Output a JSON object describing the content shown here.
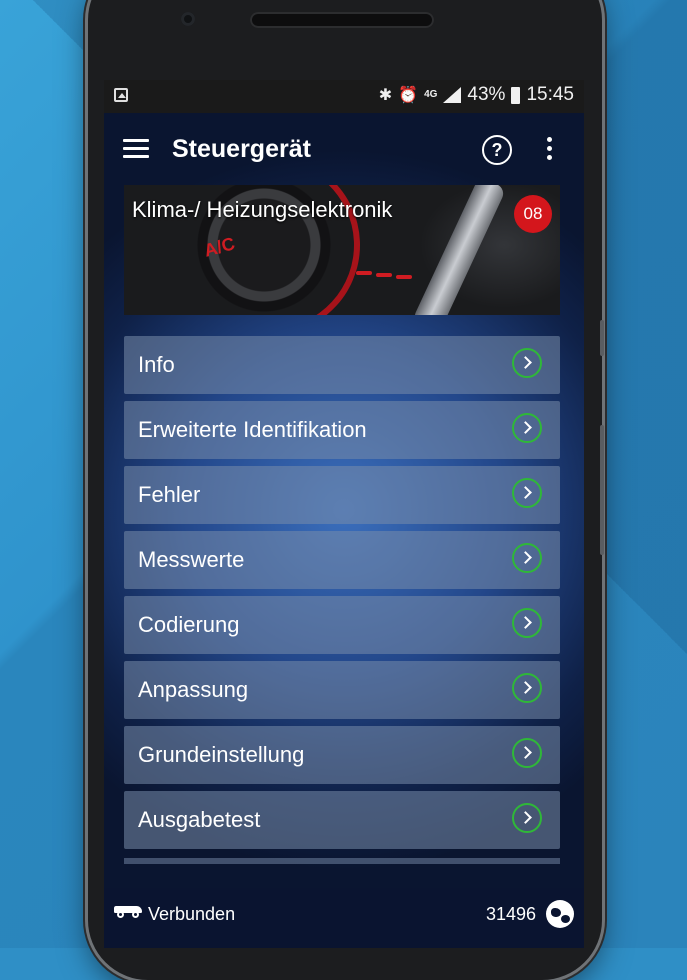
{
  "statusbar": {
    "icons": [
      "image-notification-icon",
      "bluetooth-icon",
      "alarm-icon",
      "4g-icon",
      "signal-icon",
      "battery-icon"
    ],
    "network": "4G",
    "battery": "43%",
    "time": "15:45"
  },
  "appbar": {
    "title": "Steuergerät",
    "help_symbol": "?"
  },
  "banner": {
    "title": "Klima-/ Heizungselektronik",
    "badge": "08",
    "image_text": "A/C"
  },
  "menu": {
    "items": [
      {
        "label": "Info"
      },
      {
        "label": "Erweiterte Identifikation"
      },
      {
        "label": "Fehler"
      },
      {
        "label": "Messwerte"
      },
      {
        "label": "Codierung"
      },
      {
        "label": "Anpassung"
      },
      {
        "label": "Grundeinstellung"
      },
      {
        "label": "Ausgabetest"
      }
    ]
  },
  "footer": {
    "status": "Verbunden",
    "counter": "31496"
  },
  "colors": {
    "accent_green": "#2fb838",
    "badge_red": "#d4161c",
    "background_blue": "#2f8fc6"
  }
}
